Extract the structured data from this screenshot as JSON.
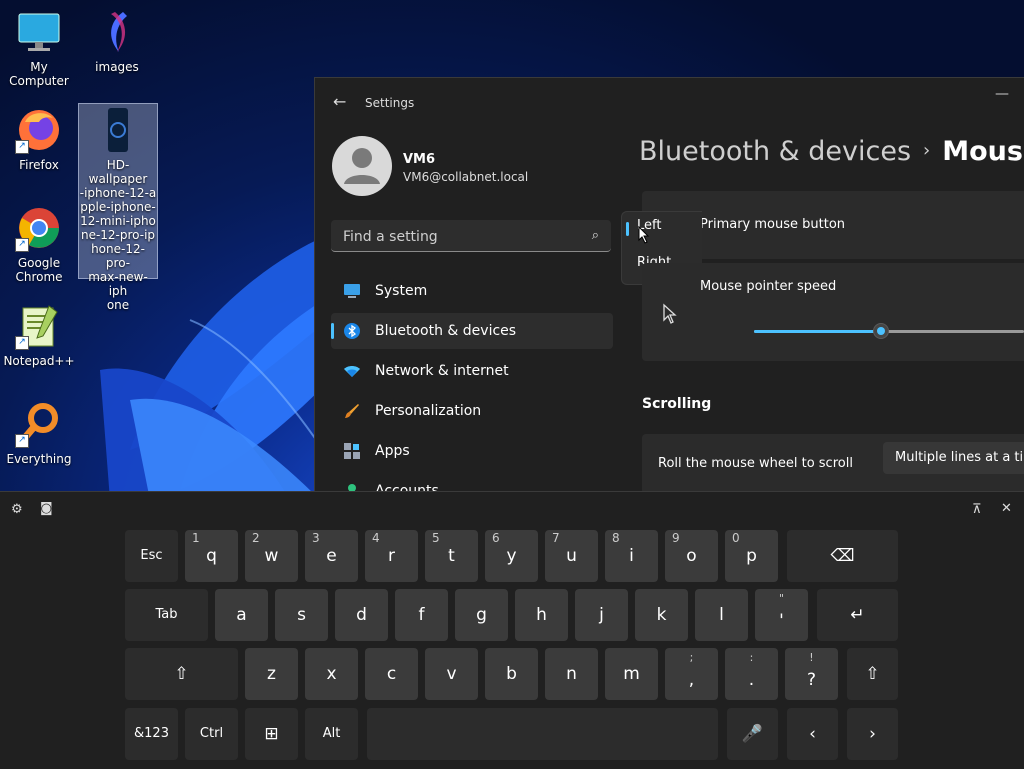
{
  "desktop": {
    "icons": [
      {
        "name": "My Computer",
        "glyph": "monitor"
      },
      {
        "name": "images",
        "glyph": "image"
      },
      {
        "name": "Firefox",
        "glyph": "firefox"
      },
      {
        "name": "HD-wallpaper-iphone-12-apple-iphone-12-mini-iphone-12-pro-iphone-12-pro-max-new-iphone",
        "glyph": "image-file"
      },
      {
        "name": "Google Chrome",
        "glyph": "chrome"
      },
      {
        "name": "Notepad++",
        "glyph": "notepad"
      },
      {
        "name": "Everything",
        "glyph": "search"
      }
    ],
    "wallpaper_label_lines": [
      "HD-wallpaper",
      "-iphone-12-a",
      "pple-iphone-",
      "12-mini-ipho",
      "ne-12-pro-ip",
      "hone-12-pro-",
      "max-new-iph",
      "one"
    ]
  },
  "settings": {
    "window_title": "Settings",
    "user": {
      "name": "VM6",
      "email": "VM6@collabnet.local"
    },
    "search_placeholder": "Find a setting",
    "nav": [
      {
        "label": "System",
        "icon": "monitor-icon"
      },
      {
        "label": "Bluetooth & devices",
        "icon": "bluetooth-icon",
        "active": true
      },
      {
        "label": "Network & internet",
        "icon": "wifi-icon"
      },
      {
        "label": "Personalization",
        "icon": "brush-icon"
      },
      {
        "label": "Apps",
        "icon": "apps-icon"
      },
      {
        "label": "Accounts",
        "icon": "person-icon"
      }
    ],
    "breadcrumb": {
      "parent": "Bluetooth & devices",
      "separator": "›",
      "current": "Mouse"
    },
    "primary_button": {
      "label": "Primary mouse button",
      "options": [
        "Left",
        "Right"
      ],
      "selected": "Left"
    },
    "pointer_speed": {
      "label": "Mouse pointer speed",
      "value_fraction": 0.47
    },
    "scrolling": {
      "heading": "Scrolling",
      "roll_label": "Roll the mouse wheel to scroll",
      "roll_value": "Multiple lines at a time"
    }
  },
  "keyboard": {
    "row1": [
      {
        "k": "Esc"
      },
      {
        "k": "q",
        "h": "1"
      },
      {
        "k": "w",
        "h": "2"
      },
      {
        "k": "e",
        "h": "3"
      },
      {
        "k": "r",
        "h": "4"
      },
      {
        "k": "t",
        "h": "5"
      },
      {
        "k": "y",
        "h": "6"
      },
      {
        "k": "u",
        "h": "7"
      },
      {
        "k": "i",
        "h": "8"
      },
      {
        "k": "o",
        "h": "9"
      },
      {
        "k": "p",
        "h": "0"
      },
      {
        "k": "⌫"
      }
    ],
    "row2": [
      {
        "k": "Tab"
      },
      {
        "k": "a"
      },
      {
        "k": "s"
      },
      {
        "k": "d"
      },
      {
        "k": "f"
      },
      {
        "k": "g"
      },
      {
        "k": "h"
      },
      {
        "k": "j"
      },
      {
        "k": "k"
      },
      {
        "k": "l"
      },
      {
        "k": "'",
        "t": "\""
      },
      {
        "k": "↵"
      }
    ],
    "row3": [
      {
        "k": "⇧"
      },
      {
        "k": "z"
      },
      {
        "k": "x"
      },
      {
        "k": "c"
      },
      {
        "k": "v"
      },
      {
        "k": "b"
      },
      {
        "k": "n"
      },
      {
        "k": "m"
      },
      {
        "k": ",",
        "t": ";"
      },
      {
        "k": ".",
        "t": ":"
      },
      {
        "k": "?",
        "t": "!"
      },
      {
        "k": "⇧"
      }
    ],
    "row4": [
      {
        "k": "&123"
      },
      {
        "k": "Ctrl"
      },
      {
        "k": "⊞"
      },
      {
        "k": "Alt"
      },
      {
        "k": ""
      },
      {
        "k": "🎤"
      },
      {
        "k": "‹"
      },
      {
        "k": "›"
      }
    ]
  }
}
